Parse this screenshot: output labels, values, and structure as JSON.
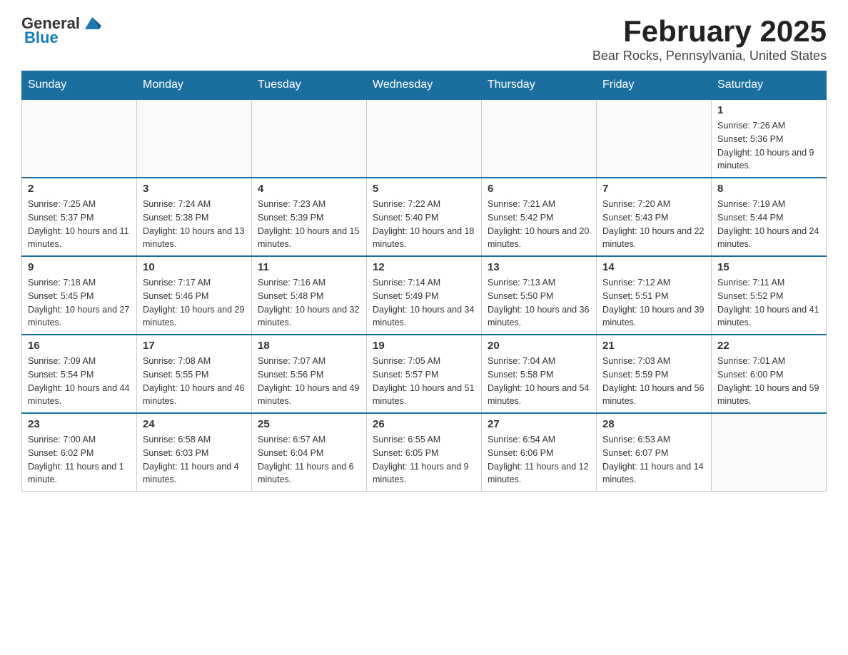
{
  "header": {
    "logo_general": "General",
    "logo_blue": "Blue",
    "title": "February 2025",
    "subtitle": "Bear Rocks, Pennsylvania, United States"
  },
  "weekdays": [
    "Sunday",
    "Monday",
    "Tuesday",
    "Wednesday",
    "Thursday",
    "Friday",
    "Saturday"
  ],
  "weeks": [
    [
      {
        "day": "",
        "info": ""
      },
      {
        "day": "",
        "info": ""
      },
      {
        "day": "",
        "info": ""
      },
      {
        "day": "",
        "info": ""
      },
      {
        "day": "",
        "info": ""
      },
      {
        "day": "",
        "info": ""
      },
      {
        "day": "1",
        "info": "Sunrise: 7:26 AM\nSunset: 5:36 PM\nDaylight: 10 hours and 9 minutes."
      }
    ],
    [
      {
        "day": "2",
        "info": "Sunrise: 7:25 AM\nSunset: 5:37 PM\nDaylight: 10 hours and 11 minutes."
      },
      {
        "day": "3",
        "info": "Sunrise: 7:24 AM\nSunset: 5:38 PM\nDaylight: 10 hours and 13 minutes."
      },
      {
        "day": "4",
        "info": "Sunrise: 7:23 AM\nSunset: 5:39 PM\nDaylight: 10 hours and 15 minutes."
      },
      {
        "day": "5",
        "info": "Sunrise: 7:22 AM\nSunset: 5:40 PM\nDaylight: 10 hours and 18 minutes."
      },
      {
        "day": "6",
        "info": "Sunrise: 7:21 AM\nSunset: 5:42 PM\nDaylight: 10 hours and 20 minutes."
      },
      {
        "day": "7",
        "info": "Sunrise: 7:20 AM\nSunset: 5:43 PM\nDaylight: 10 hours and 22 minutes."
      },
      {
        "day": "8",
        "info": "Sunrise: 7:19 AM\nSunset: 5:44 PM\nDaylight: 10 hours and 24 minutes."
      }
    ],
    [
      {
        "day": "9",
        "info": "Sunrise: 7:18 AM\nSunset: 5:45 PM\nDaylight: 10 hours and 27 minutes."
      },
      {
        "day": "10",
        "info": "Sunrise: 7:17 AM\nSunset: 5:46 PM\nDaylight: 10 hours and 29 minutes."
      },
      {
        "day": "11",
        "info": "Sunrise: 7:16 AM\nSunset: 5:48 PM\nDaylight: 10 hours and 32 minutes."
      },
      {
        "day": "12",
        "info": "Sunrise: 7:14 AM\nSunset: 5:49 PM\nDaylight: 10 hours and 34 minutes."
      },
      {
        "day": "13",
        "info": "Sunrise: 7:13 AM\nSunset: 5:50 PM\nDaylight: 10 hours and 36 minutes."
      },
      {
        "day": "14",
        "info": "Sunrise: 7:12 AM\nSunset: 5:51 PM\nDaylight: 10 hours and 39 minutes."
      },
      {
        "day": "15",
        "info": "Sunrise: 7:11 AM\nSunset: 5:52 PM\nDaylight: 10 hours and 41 minutes."
      }
    ],
    [
      {
        "day": "16",
        "info": "Sunrise: 7:09 AM\nSunset: 5:54 PM\nDaylight: 10 hours and 44 minutes."
      },
      {
        "day": "17",
        "info": "Sunrise: 7:08 AM\nSunset: 5:55 PM\nDaylight: 10 hours and 46 minutes."
      },
      {
        "day": "18",
        "info": "Sunrise: 7:07 AM\nSunset: 5:56 PM\nDaylight: 10 hours and 49 minutes."
      },
      {
        "day": "19",
        "info": "Sunrise: 7:05 AM\nSunset: 5:57 PM\nDaylight: 10 hours and 51 minutes."
      },
      {
        "day": "20",
        "info": "Sunrise: 7:04 AM\nSunset: 5:58 PM\nDaylight: 10 hours and 54 minutes."
      },
      {
        "day": "21",
        "info": "Sunrise: 7:03 AM\nSunset: 5:59 PM\nDaylight: 10 hours and 56 minutes."
      },
      {
        "day": "22",
        "info": "Sunrise: 7:01 AM\nSunset: 6:00 PM\nDaylight: 10 hours and 59 minutes."
      }
    ],
    [
      {
        "day": "23",
        "info": "Sunrise: 7:00 AM\nSunset: 6:02 PM\nDaylight: 11 hours and 1 minute."
      },
      {
        "day": "24",
        "info": "Sunrise: 6:58 AM\nSunset: 6:03 PM\nDaylight: 11 hours and 4 minutes."
      },
      {
        "day": "25",
        "info": "Sunrise: 6:57 AM\nSunset: 6:04 PM\nDaylight: 11 hours and 6 minutes."
      },
      {
        "day": "26",
        "info": "Sunrise: 6:55 AM\nSunset: 6:05 PM\nDaylight: 11 hours and 9 minutes."
      },
      {
        "day": "27",
        "info": "Sunrise: 6:54 AM\nSunset: 6:06 PM\nDaylight: 11 hours and 12 minutes."
      },
      {
        "day": "28",
        "info": "Sunrise: 6:53 AM\nSunset: 6:07 PM\nDaylight: 11 hours and 14 minutes."
      },
      {
        "day": "",
        "info": ""
      }
    ]
  ]
}
